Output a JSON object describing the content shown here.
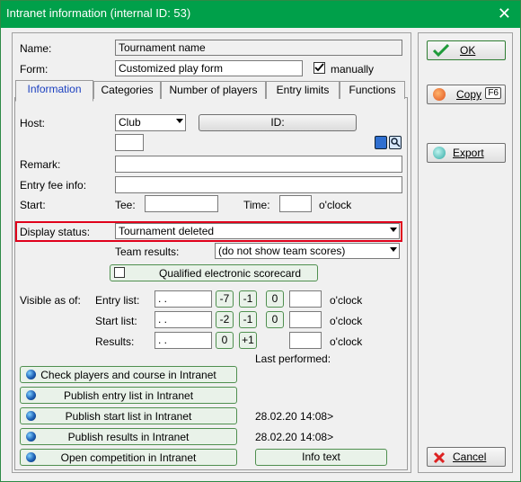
{
  "window": {
    "title": "Intranet information (internal ID: 53)"
  },
  "form": {
    "name_label": "Name:",
    "name_value": "Tournament name",
    "form_label": "Form:",
    "form_value": "Customized play form",
    "manually_label": "manually",
    "manually_checked": true
  },
  "tabs": [
    "Information",
    "Categories",
    "Number of players",
    "Entry limits",
    "Functions"
  ],
  "info": {
    "host_label": "Host:",
    "host_value": "Club",
    "id_button": "ID:",
    "remark_label": "Remark:",
    "entry_fee_label": "Entry fee info:",
    "start_label": "Start:",
    "tee_label": "Tee:",
    "time_label": "Time:",
    "oclock": "o'clock",
    "display_status_label": "Display status:",
    "display_status_value": "Tournament deleted",
    "team_results_label": "Team results:",
    "team_results_value": "(do not show team scores)",
    "qualified_button": "Qualified electronic scorecard",
    "visible_as_of": "Visible as of:",
    "entry_list_label": "Entry list:",
    "start_list_label": "Start list:",
    "results_label": "Results:",
    "date_placeholder": " .  .",
    "entry_offsets": [
      "-7",
      "-1",
      "0"
    ],
    "start_offsets": [
      "-2",
      "-1",
      "0"
    ],
    "results_offsets": [
      "0",
      "+1"
    ],
    "last_performed": "Last performed:"
  },
  "actions": {
    "check_players": "Check players and course in Intranet",
    "publish_entry": "Publish entry list in Intranet",
    "publish_start": "Publish start list in Intranet",
    "publish_start_date": "28.02.20 14:08>",
    "publish_results": "Publish results in Intranet",
    "publish_results_date": "28.02.20 14:08>",
    "open_competition": "Open competition in Intranet",
    "info_text": "Info text"
  },
  "side": {
    "ok": "OK",
    "copy": "Copy",
    "copy_key": "F6",
    "export": "Export",
    "cancel": "Cancel"
  },
  "colors": {
    "titlebar": "#00a04a",
    "highlight": "#e0001b",
    "active_tab": "#1a3fbf"
  }
}
